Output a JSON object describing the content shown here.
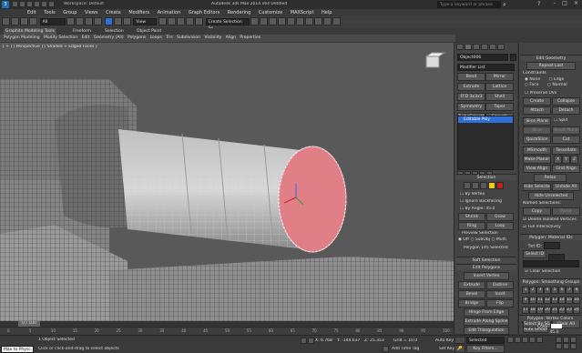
{
  "app": {
    "title": "Autodesk 3ds Max 2014 x64   Untitled",
    "search_placeholder": "Type a keyword or phrase",
    "workspace": "Workspace: Default"
  },
  "menu": [
    "Edit",
    "Tools",
    "Group",
    "Views",
    "Create",
    "Modifiers",
    "Animation",
    "Graph Editors",
    "Rendering",
    "Customize",
    "MAXScript",
    "Help"
  ],
  "main_toolbar": {
    "filter": "All",
    "view": "View",
    "selection_set": "Create Selection Se"
  },
  "ribbon": {
    "tabs": [
      "Graphite Modeling Tools",
      "Freeform",
      "Selection",
      "Object Paint"
    ],
    "panels": [
      "Polygon Modeling",
      "Modify Selection",
      "Edit",
      "Geometry (All)",
      "Polygons",
      "Loops",
      "Tris",
      "Subdivision",
      "Visibility",
      "Align",
      "Properties"
    ]
  },
  "viewport": {
    "label": "[ + ] [ Perspective ] [ Shaded + Edged Faces ]"
  },
  "command_panel": {
    "object_name": "Object006",
    "modifier_list": "Modifier List",
    "modifier_buttons": [
      "Bend",
      "Mirror",
      "Extrude",
      "Lattice",
      "FFD 3x3x3",
      "Shell",
      "Symmetry",
      "Taper",
      "TurboSmooth",
      "Smooth"
    ],
    "stack_item": "Editable Poly",
    "selection": {
      "title": "Selection",
      "by_vertex": "By Vertex",
      "ignore_backfacing": "Ignore Backfacing",
      "by_angle": "By Angle:",
      "by_angle_value": "45.0",
      "shrink": "Shrink",
      "grow": "Grow",
      "ring": "Ring",
      "loop": "Loop",
      "preview": "Preview Selection",
      "preview_opts": [
        "Off",
        "SubObj",
        "Multi"
      ],
      "status": "Polygon 145 Selected"
    },
    "soft_selection": "Soft Selection",
    "edit_polygons": {
      "title": "Edit Polygons",
      "insert_vertex": "Insert Vertex",
      "buttons": [
        "Extrude",
        "Outline",
        "Bevel",
        "Inset",
        "Bridge",
        "Flip"
      ],
      "hinge": "Hinge From Edge",
      "extrude_spline": "Extrude Along Spline",
      "edit_triangulation": "Edit Triangulation",
      "retriangulate": "Retriangulate",
      "turn": "Turn"
    }
  },
  "right_panel": {
    "edit_geometry": "Edit Geometry",
    "repeat_last": "Repeat Last",
    "constraints": "Constraints",
    "constraint_opts": [
      "None",
      "Edge",
      "Face",
      "Normal"
    ],
    "preserve_uvs": "Preserve UVs",
    "create": "Create",
    "collapse": "Collapse",
    "attach": "Attach",
    "detach": "Detach",
    "slice_plane": "Slice Plane",
    "split": "Split",
    "slice": "Slice",
    "reset_plane": "Reset Plane",
    "quickslice": "QuickSlice",
    "cut": "Cut",
    "msmooth": "MSmooth",
    "tessellate": "Tessellate",
    "make_planar": "Make Planar",
    "xyz": [
      "X",
      "Y",
      "Z"
    ],
    "view_align": "View Align",
    "grid_align": "Grid Align",
    "relax": "Relax",
    "hide_selected": "Hide Selected",
    "unhide_all": "Unhide All",
    "hide_unselected": "Hide Unselected",
    "named_selections": "Named Selections:",
    "copy": "Copy",
    "paste": "Paste",
    "delete_isolated": "Delete Isolated Vertices",
    "full_interactivity": "Full Interactivity",
    "material_ids": "Polygon: Material IDs",
    "set_id": "Set ID:",
    "select_id": "Select ID",
    "clear_selection": "Clear Selection",
    "smoothing_groups": "Polygon: Smoothing Groups",
    "sg_numbers": [
      "1",
      "2",
      "3",
      "4",
      "5",
      "6",
      "7",
      "8",
      "9",
      "10",
      "11",
      "12",
      "13",
      "14",
      "15",
      "16",
      "17",
      "18",
      "19",
      "20",
      "21",
      "22",
      "23",
      "24",
      "25",
      "26",
      "27",
      "28",
      "29",
      "30",
      "31",
      "32"
    ],
    "select_by_sg": "Select By SG",
    "clear_all": "Clear All",
    "auto_smooth": "Auto Smooth",
    "auto_smooth_value": "45.0",
    "vertex_colors": "Polygon: Vertex Colors",
    "color": "Color:"
  },
  "timeline": {
    "frame": "0 / 100",
    "ticks": [
      "0",
      "5",
      "10",
      "15",
      "20",
      "25",
      "30",
      "35",
      "40",
      "45",
      "50",
      "55",
      "60",
      "65",
      "70",
      "75",
      "80",
      "85",
      "90",
      "95",
      "100"
    ]
  },
  "status": {
    "maxscript": "Max to Physc.",
    "selected": "1 Object Selected",
    "prompt": "Click or click-and-drag to select objects",
    "x": "X: 6.768",
    "y": "Y: -144.637",
    "z": "Z: 25.353",
    "grid": "Grid = 10.0",
    "autokey": "Auto Key",
    "autokey_mode": "Selected",
    "set_key": "Set Key",
    "key_filters": "Key Filters...",
    "add_time_tag": "Add Time Tag"
  },
  "colors": {
    "cap_fill": "#e07f85",
    "accent_blue": "#2f6fd6",
    "selected_yellow": "#f0d000"
  }
}
